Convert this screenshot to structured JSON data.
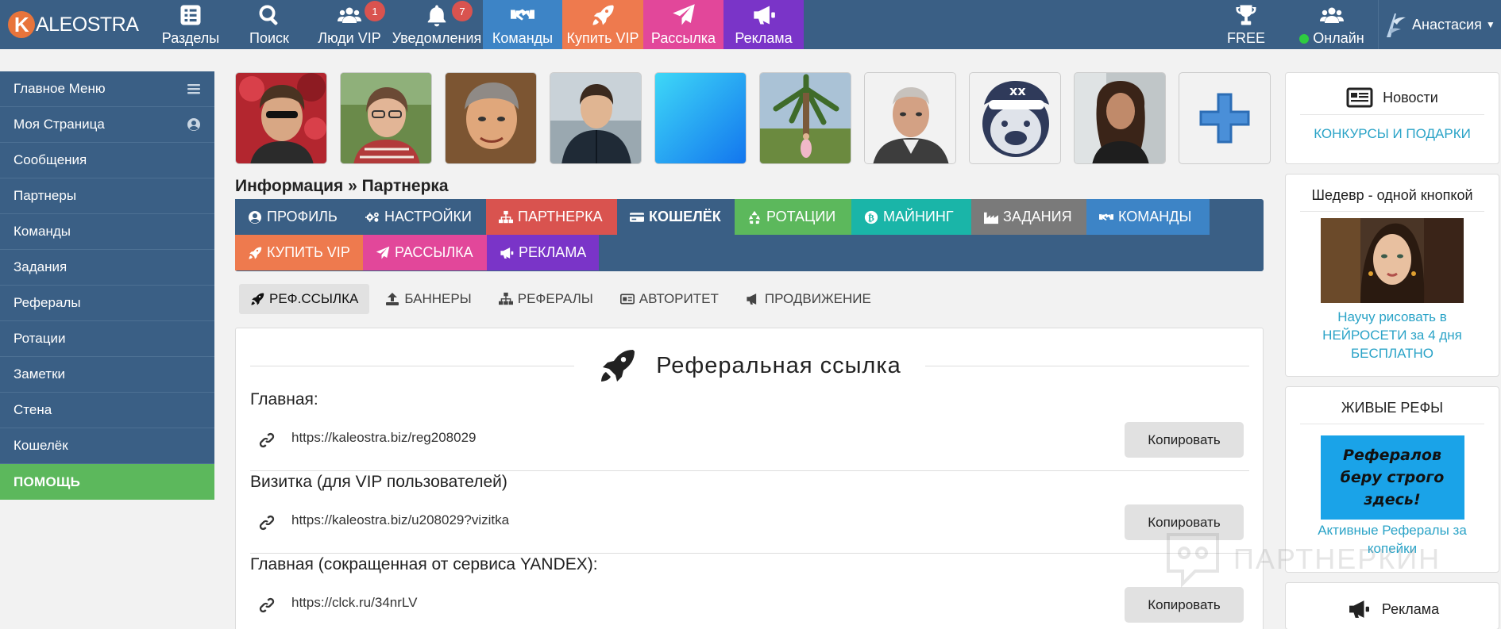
{
  "logo": {
    "letter": "K",
    "text": "ALEOSTRA"
  },
  "nav": [
    {
      "label": "Разделы",
      "icon": "list-icon"
    },
    {
      "label": "Поиск",
      "icon": "search-icon"
    },
    {
      "label": "Люди VIP",
      "icon": "users-icon",
      "badge": "1"
    },
    {
      "label": "Уведомления",
      "icon": "bell-icon",
      "badge": "7"
    },
    {
      "label": "Команды",
      "icon": "handshake-icon",
      "color": "#3d84c6"
    },
    {
      "label": "Купить VIP",
      "icon": "rocket-icon",
      "color": "#ee7a4e"
    },
    {
      "label": "Рассылка",
      "icon": "paper-plane-icon",
      "color": "#e2479a"
    },
    {
      "label": "Реклама",
      "icon": "megaphone-icon",
      "color": "#7a34c8"
    }
  ],
  "nav_right": [
    {
      "label": "FREE",
      "icon": "trophy-icon"
    },
    {
      "label": "Онлайн",
      "icon": "users-icon"
    }
  ],
  "user": {
    "name": "Анастасия"
  },
  "sidebar": [
    {
      "label": "Главное Меню",
      "icon": "bars-icon"
    },
    {
      "label": "Моя Страница",
      "icon": "user-circle-icon"
    },
    {
      "label": "Сообщения"
    },
    {
      "label": "Партнеры"
    },
    {
      "label": "Команды"
    },
    {
      "label": "Задания"
    },
    {
      "label": "Рефералы"
    },
    {
      "label": "Ротации"
    },
    {
      "label": "Заметки"
    },
    {
      "label": "Стена"
    },
    {
      "label": "Кошелёк"
    },
    {
      "label": "ПОМОЩЬ"
    }
  ],
  "breadcrumb": {
    "section": "Информация",
    "separator": " » ",
    "page": "Партнерка"
  },
  "tabs": [
    {
      "label": "Профиль",
      "icon": "user-circle-icon",
      "color": "#3a5f85"
    },
    {
      "label": "Настройки",
      "icon": "cogs-icon",
      "color": "#3a5f85"
    },
    {
      "label": "Партнерка",
      "icon": "sitemap-icon",
      "color": "#d9534f"
    },
    {
      "label": "Кошелёк",
      "icon": "credit-card-icon",
      "color": "#3a5f85"
    },
    {
      "label": "Ротации",
      "icon": "recycle-icon",
      "color": "#5cb85c"
    },
    {
      "label": "Майнинг",
      "icon": "bitcoin-icon",
      "color": "#1ab5a8"
    },
    {
      "label": "Задания",
      "icon": "industry-icon",
      "color": "#7a7a7a"
    },
    {
      "label": "Команды",
      "icon": "handshake-icon",
      "color": "#3d84c6"
    },
    {
      "label": "Купить VIP",
      "icon": "rocket-icon",
      "color": "#ee7a4e"
    },
    {
      "label": "Рассылка",
      "icon": "paper-plane-icon",
      "color": "#e2479a"
    },
    {
      "label": "Реклама",
      "icon": "megaphone-icon",
      "color": "#7a34c8"
    }
  ],
  "subtabs": [
    {
      "label": "РЕФ.ССЫЛКА",
      "icon": "rocket-icon",
      "active": true
    },
    {
      "label": "БАННЕРЫ",
      "icon": "upload-icon"
    },
    {
      "label": "РЕФЕРАЛЫ",
      "icon": "sitemap-icon"
    },
    {
      "label": "АВТОРИТЕТ",
      "icon": "id-card-icon"
    },
    {
      "label": "ПРОДВИЖЕНИЕ",
      "icon": "bullhorn-icon"
    }
  ],
  "content": {
    "title": "Реферальная ссылка",
    "copy_label": "Копировать",
    "links": [
      {
        "label": "Главная:",
        "url": "https://kaleostra.biz/reg208029"
      },
      {
        "label": "Визитка (для VIP пользователей)",
        "url": "https://kaleostra.biz/u208029?vizitka"
      },
      {
        "label": "Главная (сокращенная от сервиса YANDEX):",
        "url": "https://clck.ru/34nrLV"
      }
    ]
  },
  "right": {
    "news_title": "Новости",
    "news_link": "КОНКУРСЫ И ПОДАРКИ",
    "promo_title": "Шедевр - одной кнопкой",
    "promo_link": "Научу рисовать в НЕЙРОСЕТИ за 4 дня БЕСПЛАТНО",
    "refs_title": "ЖИВЫЕ РЕФЫ",
    "refs_banner": "Рефералов беру строго здесь!",
    "refs_link": "Активные Рефералы за копейки",
    "ads_title": "Реклама"
  },
  "watermark": "ПАРТНЕРКИН"
}
